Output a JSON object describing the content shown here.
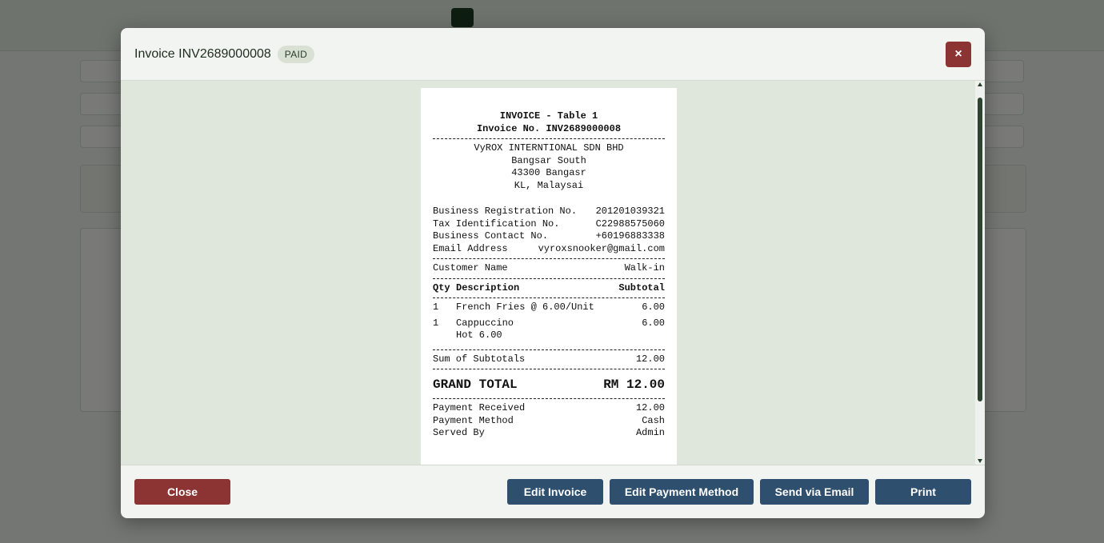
{
  "modal": {
    "title": "Invoice INV2689000008",
    "status_badge": "PAID",
    "close_symbol": "×"
  },
  "receipt": {
    "header_line1": "INVOICE - Table 1",
    "header_line2": "Invoice No. INV2689000008",
    "company_name": "VyROX INTERNTIONAL SDN BHD",
    "address_line1": "Bangsar South",
    "address_line2": "43300 Bangasr",
    "address_line3": "KL, Malaysai",
    "business_info": [
      {
        "label": "Business Registration No.",
        "value": "201201039321"
      },
      {
        "label": "Tax Identification No.",
        "value": "C22988575060"
      },
      {
        "label": "Business Contact No.",
        "value": "+60196883338"
      },
      {
        "label": "Email Address",
        "value": "vyroxsnooker@gmail.com"
      }
    ],
    "customer_label": "Customer Name",
    "customer_value": "Walk-in",
    "columns": {
      "qty": "Qty",
      "description": "Description",
      "subtotal": "Subtotal"
    },
    "items": [
      {
        "qty": "1",
        "description": "French Fries @ 6.00/Unit",
        "subtotal": "6.00",
        "sub_line": ""
      },
      {
        "qty": "1",
        "description": "Cappuccino",
        "subtotal": "6.00",
        "sub_line": "Hot 6.00"
      }
    ],
    "sum_label": "Sum of Subtotals",
    "sum_value": "12.00",
    "grand_total_label": "GRAND TOTAL",
    "grand_total_value": "RM 12.00",
    "payment_info": [
      {
        "label": "Payment Received",
        "value": "12.00"
      },
      {
        "label": "Payment Method",
        "value": "Cash"
      },
      {
        "label": "Served By",
        "value": "Admin"
      }
    ]
  },
  "footer": {
    "close_label": "Close",
    "edit_invoice_label": "Edit Invoice",
    "edit_payment_label": "Edit Payment Method",
    "send_email_label": "Send via Email",
    "print_label": "Print"
  },
  "colors": {
    "danger": "#8c3434",
    "primary": "#2f4f6e",
    "modal_body": "#dfe7dc",
    "scroll_thumb": "#2e4430"
  }
}
